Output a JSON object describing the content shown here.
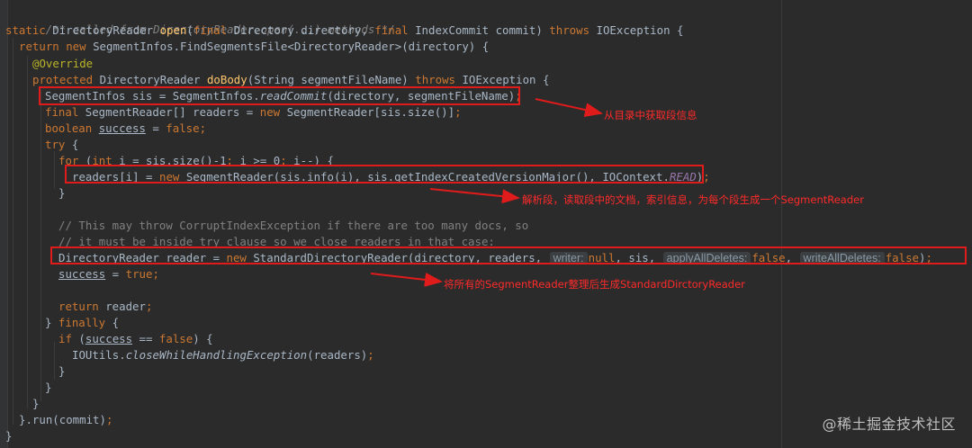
{
  "code_lines": {
    "l1": "/** called from DirectoryReader.open(...) methods */",
    "l2": {
      "kw1": "static ",
      "t1": "DirectoryReader ",
      "fn": "open",
      "t2": "(",
      "kw2": "final ",
      "t3": "Directory directory, ",
      "kw3": "final ",
      "t4": "IndexCommit commit) ",
      "kw4": "throws ",
      "t5": "IOException {"
    },
    "l3": {
      "kw1": "return new ",
      "t1": "SegmentInfos.FindSegmentsFile<DirectoryReader>(directory) {"
    },
    "l4": "@Override",
    "l5": {
      "kw1": "protected ",
      "t1": "DirectoryReader ",
      "fn": "doBody",
      "t2": "(String segmentFileName) ",
      "kw2": "throws ",
      "t3": "IOException {"
    },
    "l6": {
      "t1": "SegmentInfos sis = SegmentInfos.",
      "st": "readCommit",
      "t2": "(directory, segmentFileName)",
      "p": ";"
    },
    "l7": {
      "kw1": "final ",
      "t1": "SegmentReader[] readers = ",
      "kw2": "new ",
      "t2": "SegmentReader[sis.size()]",
      "p": ";"
    },
    "l8": {
      "kw1": "boolean ",
      "t1": "success",
      "t2": " = ",
      "kw2": "false",
      "p": ";"
    },
    "l9": {
      "kw1": "try ",
      "t1": "{"
    },
    "l10": {
      "kw1": "for ",
      "t1": "(",
      "kw2": "int ",
      "t2": "i = sis.size()-",
      "n1": "1",
      "p1": "; ",
      "t3": "i >= ",
      "n2": "0",
      "p2": "; ",
      "t4": "i--) {"
    },
    "l11": {
      "t1": "readers[i] = ",
      "kw1": "new ",
      "t2": "SegmentReader(sis.info(i), sis.getIndexCreatedVersionMajor(), IOContext.",
      "sc": "READ",
      "t3": ")",
      "p": ";"
    },
    "l12": "}",
    "l13": "// This may throw CorruptIndexException if there are too many docs, so",
    "l14": "// it must be inside try clause so we close readers in that case:",
    "l15": {
      "t1": "DirectoryReader reader = ",
      "kw1": "new ",
      "t2": "StandardDirectoryReader(directory, readers, ",
      "h1": "writer:",
      "kw2": "null",
      "t3": ", sis, ",
      "h2": "applyAllDeletes:",
      "kw3": "false",
      "t4": ", ",
      "h3": "writeAllDeletes:",
      "kw4": "false",
      "t5": ")",
      "p": ";"
    },
    "l16": {
      "t1": "success",
      "t2": " = ",
      "kw1": "true",
      "p": ";"
    },
    "l17": {
      "kw1": "return ",
      "t1": "reader",
      "p": ";"
    },
    "l18": {
      "t1": "} ",
      "kw1": "finally ",
      "t2": "{"
    },
    "l19": {
      "kw1": "if ",
      "t1": "(",
      "t2": "success",
      "t3": " == ",
      "kw2": "false",
      "t4": ") {"
    },
    "l20": {
      "t1": "IOUtils.",
      "st": "closeWhileHandlingException",
      "t2": "(readers)",
      "p": ";"
    },
    "l21": "}",
    "l22": "}",
    "l23": "}",
    "l24": {
      "t1": "}.run(commit)",
      "p": ";"
    },
    "l25": "}"
  },
  "annotations": {
    "a1": "从目录中获取段信息",
    "a2": "解析段，读取段中的文档，索引信息，为每个段生成一个SegmentReader",
    "a3": "将所有的SegmentReader整理后生成StandardDirctoryReader"
  },
  "colors": {
    "background": "#2b2b2b",
    "keyword": "#cc7832",
    "comment": "#808080",
    "method": "#ffc66d",
    "annotation": "#bbb529",
    "highlight_box": "#e01b1b",
    "annotation_text": "#ff2a2a"
  },
  "watermark": "@稀土掘金技术社区"
}
